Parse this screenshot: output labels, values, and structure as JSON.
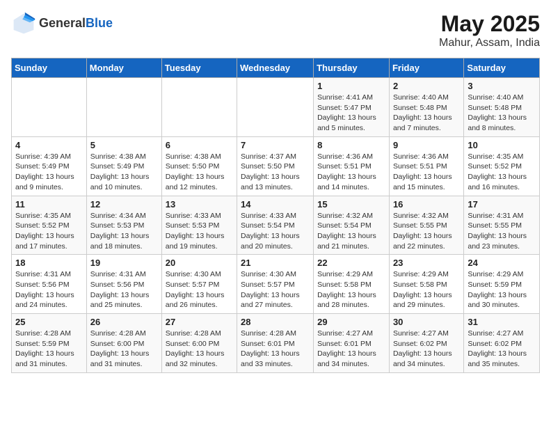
{
  "header": {
    "logo_general": "General",
    "logo_blue": "Blue",
    "title": "May 2025",
    "subtitle": "Mahur, Assam, India"
  },
  "days_of_week": [
    "Sunday",
    "Monday",
    "Tuesday",
    "Wednesday",
    "Thursday",
    "Friday",
    "Saturday"
  ],
  "weeks": [
    [
      {
        "day": "",
        "detail": ""
      },
      {
        "day": "",
        "detail": ""
      },
      {
        "day": "",
        "detail": ""
      },
      {
        "day": "",
        "detail": ""
      },
      {
        "day": "1",
        "detail": "Sunrise: 4:41 AM\nSunset: 5:47 PM\nDaylight: 13 hours\nand 5 minutes."
      },
      {
        "day": "2",
        "detail": "Sunrise: 4:40 AM\nSunset: 5:48 PM\nDaylight: 13 hours\nand 7 minutes."
      },
      {
        "day": "3",
        "detail": "Sunrise: 4:40 AM\nSunset: 5:48 PM\nDaylight: 13 hours\nand 8 minutes."
      }
    ],
    [
      {
        "day": "4",
        "detail": "Sunrise: 4:39 AM\nSunset: 5:49 PM\nDaylight: 13 hours\nand 9 minutes."
      },
      {
        "day": "5",
        "detail": "Sunrise: 4:38 AM\nSunset: 5:49 PM\nDaylight: 13 hours\nand 10 minutes."
      },
      {
        "day": "6",
        "detail": "Sunrise: 4:38 AM\nSunset: 5:50 PM\nDaylight: 13 hours\nand 12 minutes."
      },
      {
        "day": "7",
        "detail": "Sunrise: 4:37 AM\nSunset: 5:50 PM\nDaylight: 13 hours\nand 13 minutes."
      },
      {
        "day": "8",
        "detail": "Sunrise: 4:36 AM\nSunset: 5:51 PM\nDaylight: 13 hours\nand 14 minutes."
      },
      {
        "day": "9",
        "detail": "Sunrise: 4:36 AM\nSunset: 5:51 PM\nDaylight: 13 hours\nand 15 minutes."
      },
      {
        "day": "10",
        "detail": "Sunrise: 4:35 AM\nSunset: 5:52 PM\nDaylight: 13 hours\nand 16 minutes."
      }
    ],
    [
      {
        "day": "11",
        "detail": "Sunrise: 4:35 AM\nSunset: 5:52 PM\nDaylight: 13 hours\nand 17 minutes."
      },
      {
        "day": "12",
        "detail": "Sunrise: 4:34 AM\nSunset: 5:53 PM\nDaylight: 13 hours\nand 18 minutes."
      },
      {
        "day": "13",
        "detail": "Sunrise: 4:33 AM\nSunset: 5:53 PM\nDaylight: 13 hours\nand 19 minutes."
      },
      {
        "day": "14",
        "detail": "Sunrise: 4:33 AM\nSunset: 5:54 PM\nDaylight: 13 hours\nand 20 minutes."
      },
      {
        "day": "15",
        "detail": "Sunrise: 4:32 AM\nSunset: 5:54 PM\nDaylight: 13 hours\nand 21 minutes."
      },
      {
        "day": "16",
        "detail": "Sunrise: 4:32 AM\nSunset: 5:55 PM\nDaylight: 13 hours\nand 22 minutes."
      },
      {
        "day": "17",
        "detail": "Sunrise: 4:31 AM\nSunset: 5:55 PM\nDaylight: 13 hours\nand 23 minutes."
      }
    ],
    [
      {
        "day": "18",
        "detail": "Sunrise: 4:31 AM\nSunset: 5:56 PM\nDaylight: 13 hours\nand 24 minutes."
      },
      {
        "day": "19",
        "detail": "Sunrise: 4:31 AM\nSunset: 5:56 PM\nDaylight: 13 hours\nand 25 minutes."
      },
      {
        "day": "20",
        "detail": "Sunrise: 4:30 AM\nSunset: 5:57 PM\nDaylight: 13 hours\nand 26 minutes."
      },
      {
        "day": "21",
        "detail": "Sunrise: 4:30 AM\nSunset: 5:57 PM\nDaylight: 13 hours\nand 27 minutes."
      },
      {
        "day": "22",
        "detail": "Sunrise: 4:29 AM\nSunset: 5:58 PM\nDaylight: 13 hours\nand 28 minutes."
      },
      {
        "day": "23",
        "detail": "Sunrise: 4:29 AM\nSunset: 5:58 PM\nDaylight: 13 hours\nand 29 minutes."
      },
      {
        "day": "24",
        "detail": "Sunrise: 4:29 AM\nSunset: 5:59 PM\nDaylight: 13 hours\nand 30 minutes."
      }
    ],
    [
      {
        "day": "25",
        "detail": "Sunrise: 4:28 AM\nSunset: 5:59 PM\nDaylight: 13 hours\nand 31 minutes."
      },
      {
        "day": "26",
        "detail": "Sunrise: 4:28 AM\nSunset: 6:00 PM\nDaylight: 13 hours\nand 31 minutes."
      },
      {
        "day": "27",
        "detail": "Sunrise: 4:28 AM\nSunset: 6:00 PM\nDaylight: 13 hours\nand 32 minutes."
      },
      {
        "day": "28",
        "detail": "Sunrise: 4:28 AM\nSunset: 6:01 PM\nDaylight: 13 hours\nand 33 minutes."
      },
      {
        "day": "29",
        "detail": "Sunrise: 4:27 AM\nSunset: 6:01 PM\nDaylight: 13 hours\nand 34 minutes."
      },
      {
        "day": "30",
        "detail": "Sunrise: 4:27 AM\nSunset: 6:02 PM\nDaylight: 13 hours\nand 34 minutes."
      },
      {
        "day": "31",
        "detail": "Sunrise: 4:27 AM\nSunset: 6:02 PM\nDaylight: 13 hours\nand 35 minutes."
      }
    ]
  ]
}
